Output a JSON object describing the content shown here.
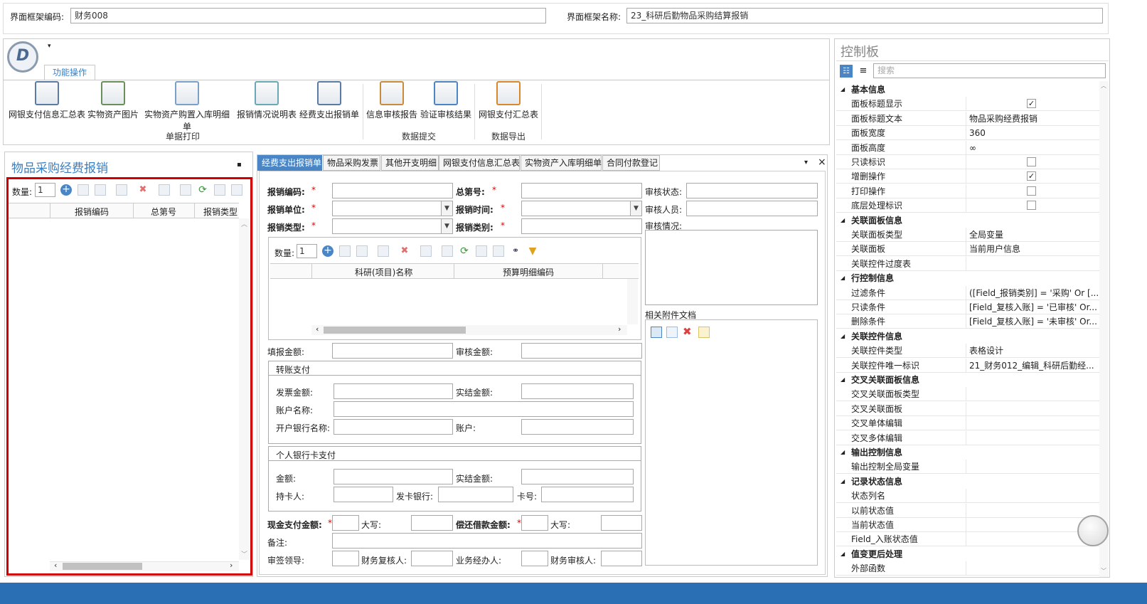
{
  "header": {
    "code_label": "界面框架编码:",
    "code_value": "财务008",
    "name_label": "界面框架名称:",
    "name_value": "23_科研后勤物品采购结算报销"
  },
  "ribbon": {
    "tab": "功能操作",
    "buttons": [
      {
        "label": "网银支付信息汇总表",
        "icon": "printer-icon"
      },
      {
        "label": "实物资产图片",
        "icon": "printer-help-icon"
      },
      {
        "label": "实物资产购置入库明细单",
        "icon": "document-print-icon"
      },
      {
        "label": "报销情况说明表",
        "icon": "table-print-icon"
      },
      {
        "label": "经费支出报销单",
        "icon": "report-print-icon"
      },
      {
        "label": "信息审核报告",
        "icon": "edit-report-icon"
      },
      {
        "label": "验证审核结果",
        "icon": "grid-edit-icon"
      },
      {
        "label": "网银支付汇总表",
        "icon": "export-box-icon"
      }
    ],
    "groups": [
      "单据打印",
      "数据提交",
      "数据导出"
    ]
  },
  "left_panel": {
    "title": "物品采购经费报销",
    "qty_label": "数量:",
    "qty_value": "1",
    "columns": [
      "报销编码",
      "总第号",
      "报销类型"
    ]
  },
  "tabs": [
    "经费支出报销单",
    "物品采购发票",
    "其他开支明细",
    "网银支付信息汇总表",
    "实物资产入库明细单",
    "合同付款登记"
  ],
  "form": {
    "f1": "报销编码:",
    "f2": "总第号:",
    "f3": "审核状态:",
    "f4": "报销单位:",
    "f5": "报销时间:",
    "f6": "审核人员:",
    "f7": "报销类型:",
    "f8": "报销类别:",
    "f9": "审核情况:",
    "req": "*",
    "inner_qty_label": "数量:",
    "inner_qty_value": "1",
    "inner_cols": [
      "科研(项目)名称",
      "预算明细编码"
    ],
    "attach_label": "相关附件文档",
    "fill_amount": "填报金额:",
    "audit_amount": "审核金额:",
    "transfer_title": "转账支付",
    "invoice_amount": "发票金额:",
    "settle_amount": "实结金额:",
    "account_name": "账户名称:",
    "bank_name": "开户银行名称:",
    "account": "账户:",
    "card_title": "个人银行卡支付",
    "amount": "金额:",
    "settle_amount2": "实结金额:",
    "holder": "持卡人:",
    "issuing_bank": "发卡银行:",
    "card_no": "卡号:",
    "cash_amount": "现金支付金额:",
    "upper1": "大写:",
    "repay_amount": "偿还借款金额:",
    "upper2": "大写:",
    "remark": "备注:",
    "approver": "审签领导:",
    "reviewer": "财务复核人:",
    "handler": "业务经办人:",
    "auditor": "财务审核人:"
  },
  "control_panel": {
    "title": "控制板",
    "search_placeholder": "搜索",
    "rows": [
      {
        "type": "cat",
        "k": "基本信息"
      },
      {
        "k": "面板标题显示",
        "check": true
      },
      {
        "k": "面板标题文本",
        "v": "物品采购经费报销"
      },
      {
        "k": "面板宽度",
        "v": "360"
      },
      {
        "k": "面板高度",
        "v": "∞"
      },
      {
        "k": "只读标识",
        "check": false
      },
      {
        "k": "增删操作",
        "check": true
      },
      {
        "k": "打印操作",
        "check": false
      },
      {
        "k": "底层处理标识",
        "check": false
      },
      {
        "type": "cat",
        "k": "关联面板信息"
      },
      {
        "k": "关联面板类型",
        "v": "全局变量"
      },
      {
        "k": "关联面板",
        "v": "当前用户信息"
      },
      {
        "k": "关联控件过度表",
        "v": ""
      },
      {
        "type": "cat",
        "k": "行控制信息"
      },
      {
        "k": "过滤条件",
        "v": "([Field_报销类别] = '采购' Or [..."
      },
      {
        "k": "只读条件",
        "v": "[Field_复核入账] = '已审核' Or..."
      },
      {
        "k": "删除条件",
        "v": "[Field_复核入账] = '未审核' Or..."
      },
      {
        "type": "cat",
        "k": "关联控件信息"
      },
      {
        "k": "关联控件类型",
        "v": "表格设计"
      },
      {
        "k": "关联控件唯一标识",
        "v": "21_财务012_编辑_科研后勤经..."
      },
      {
        "type": "cat",
        "k": "交叉关联面板信息"
      },
      {
        "k": "交叉关联面板类型",
        "v": ""
      },
      {
        "k": "交叉关联面板",
        "v": ""
      },
      {
        "k": "交叉单体编辑",
        "v": ""
      },
      {
        "k": "交叉多体编辑",
        "v": ""
      },
      {
        "type": "cat",
        "k": "输出控制信息"
      },
      {
        "k": "输出控制全局变量",
        "v": ""
      },
      {
        "type": "cat",
        "k": "记录状态信息"
      },
      {
        "k": "状态列名",
        "v": ""
      },
      {
        "k": "以前状态值",
        "v": ""
      },
      {
        "k": "当前状态值",
        "v": ""
      },
      {
        "k": "Field_入账状态值",
        "v": ""
      },
      {
        "type": "cat",
        "k": "值变更后处理"
      },
      {
        "k": "外部函数",
        "v": ""
      }
    ]
  },
  "colors": {
    "accent": "#4a86c6",
    "highlight_border": "#d00000",
    "title_blue": "#3c7fc1"
  }
}
